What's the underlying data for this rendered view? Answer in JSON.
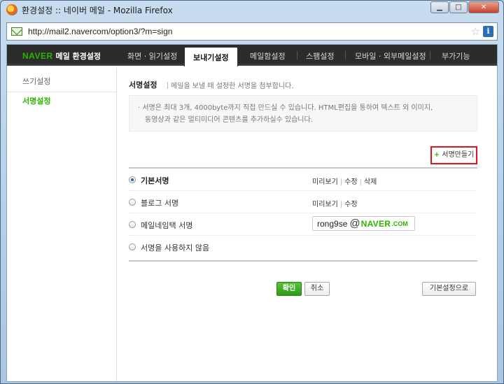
{
  "window": {
    "title": "환경설정 :: 네이버 메일 - Mozilla Firefox",
    "minimize_label": "▁",
    "maximize_label": "□",
    "close_label": "✕"
  },
  "urlbar": {
    "url": "http://mail2.navercom/option3/?m=sign"
  },
  "header": {
    "brand_naver": "NAVER",
    "brand_text": "메일 환경설정",
    "tabs": [
      {
        "label": "화면 · 읽기설정"
      },
      {
        "label": "보내기설정",
        "active": true
      },
      {
        "label": "메일함설정"
      },
      {
        "label": "스팸설정"
      },
      {
        "label": "모바일 · 외부메일설정"
      },
      {
        "label": "부가기능"
      }
    ]
  },
  "sidebar": {
    "items": [
      {
        "label": "쓰기설정"
      },
      {
        "label": "서명설정",
        "active": true
      }
    ]
  },
  "main": {
    "title": "서명설정",
    "description": "메일을 보낼 때 설정한 서명을 첨부합니다.",
    "notice_line1": "· 서명은 최대 3개, 4000byte까지 직접 만드실 수 있습니다. HTML편집을 통하여 텍스트 외 이미지,",
    "notice_line2": "동영상과 같은 멀티미디어 콘텐츠를 추가하실수 있습니다.",
    "create_button_plus": "+",
    "create_button_label": "서명만들기",
    "signatures": [
      {
        "label": "기본서명",
        "checked": true,
        "preview": "미리보기",
        "edit": "수정",
        "delete": "삭제"
      },
      {
        "label": "블로그 서명",
        "checked": false,
        "preview": "미리보기",
        "edit": "수정"
      },
      {
        "label": "메일네임택 서명",
        "checked": false,
        "email_user": "rong9se",
        "email_at": "@",
        "email_naver": "NAVER",
        "email_domain": ".COM"
      },
      {
        "label": "서명을 사용하지 않음",
        "checked": false
      }
    ],
    "separator": "|",
    "ok_label": "확인",
    "cancel_label": "취소",
    "default_label": "기본설정으로"
  },
  "colors": {
    "naver_green": "#2db400",
    "highlight_red": "#e0141c",
    "nav_dark": "#2c2c2c"
  }
}
